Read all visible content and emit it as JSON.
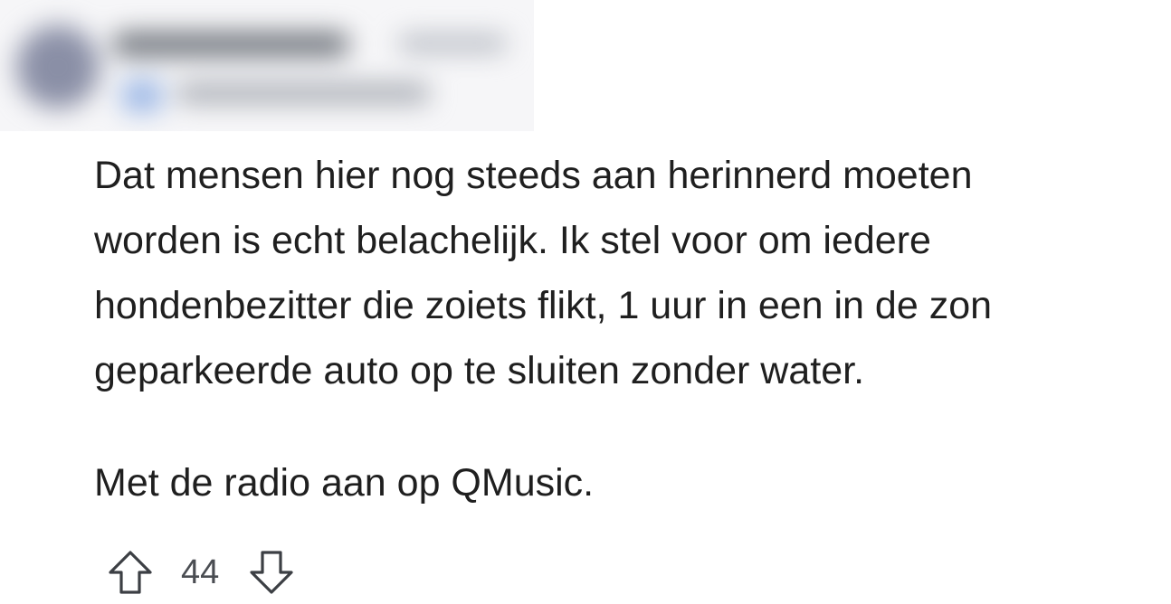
{
  "comment": {
    "paragraphs": [
      {
        "lines": [
          "Dat mensen hier nog steeds aan herinnerd moeten",
          "worden is echt belachelijk. Ik stel voor om iedere",
          "hondenbezitter die zoiets flikt, 1 uur in een in de zon",
          "geparkeerde auto op te sluiten zonder water."
        ]
      },
      {
        "lines": [
          "Met de radio aan op QMusic."
        ]
      }
    ]
  },
  "votes": {
    "score": "44",
    "upvote_icon": "arrow-up-outline-icon",
    "downvote_icon": "arrow-down-outline-icon"
  },
  "colors": {
    "text": "#1f1f1f",
    "vote_text": "#4a4d52",
    "icon_stroke": "#3c3f44"
  }
}
